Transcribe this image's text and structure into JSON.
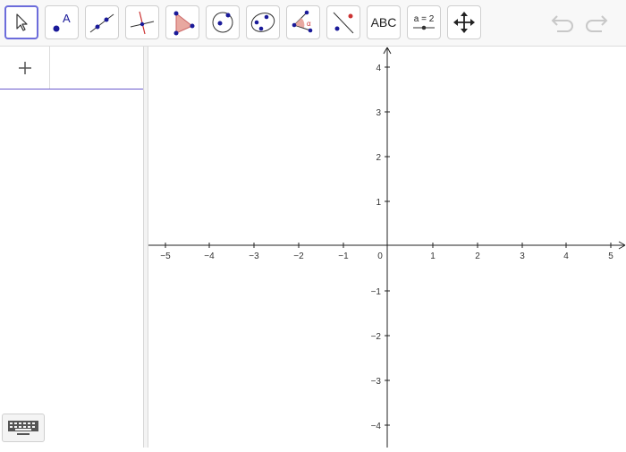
{
  "toolbar": {
    "tools": [
      {
        "name": "move-tool",
        "icon": "arrow-pointer-icon",
        "active": true
      },
      {
        "name": "point-tool",
        "icon": "point-with-label-icon"
      },
      {
        "name": "line-tool",
        "icon": "line-through-two-points-icon"
      },
      {
        "name": "perpendicular-line-tool",
        "icon": "perpendicular-line-icon"
      },
      {
        "name": "polygon-tool",
        "icon": "polygon-icon"
      },
      {
        "name": "circle-tool",
        "icon": "circle-with-center-icon"
      },
      {
        "name": "ellipse-tool",
        "icon": "ellipse-icon"
      },
      {
        "name": "angle-tool",
        "icon": "angle-icon"
      },
      {
        "name": "reflect-tool",
        "icon": "reflect-about-line-icon"
      },
      {
        "name": "text-tool",
        "icon": "text-icon",
        "label": "ABC"
      },
      {
        "name": "slider-tool",
        "icon": "slider-icon",
        "label": "a = 2"
      },
      {
        "name": "move-graphics-view-tool",
        "icon": "move-arrows-icon"
      }
    ],
    "undo_icon": "undo-icon",
    "redo_icon": "redo-icon"
  },
  "algebra": {
    "add_icon": "plus-icon",
    "keyboard_icon": "keyboard-icon"
  },
  "graphics": {
    "x_ticks": [
      "−5",
      "−4",
      "−3",
      "−2",
      "−1",
      "0",
      "1",
      "2",
      "3",
      "4",
      "5"
    ],
    "y_ticks_positive": [
      "1",
      "2",
      "3",
      "4"
    ],
    "y_ticks_negative": [
      "−1",
      "−2",
      "−3",
      "−4"
    ],
    "x_range": [
      -5,
      5
    ],
    "y_range": [
      -4,
      4
    ]
  },
  "colors": {
    "accent": "#6c6cdb",
    "point": "#1a1a99",
    "polygon_fill": "#e8a8a0",
    "line_red": "#cc3333"
  }
}
